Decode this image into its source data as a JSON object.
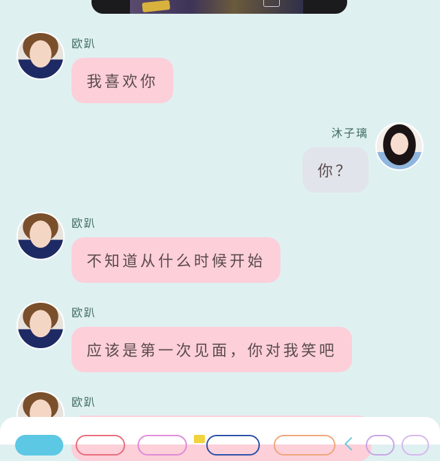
{
  "messages": [
    {
      "sender": "欧趴",
      "text": "我喜欢你",
      "side": "left"
    },
    {
      "sender": "沐子璃",
      "text": "你？",
      "side": "right"
    },
    {
      "sender": "欧趴",
      "text": "不知道从什么时候开始",
      "side": "left"
    },
    {
      "sender": "欧趴",
      "text": "应该是第一次见面，你对我笑吧",
      "side": "left"
    },
    {
      "sender": "欧趴",
      "text": "",
      "side": "left"
    }
  ],
  "colors": {
    "background": "#dff0f1",
    "bubble_left": "#fccfd9",
    "bubble_right": "#e1e4ea",
    "name": "#3f6a62"
  },
  "toolbar": {
    "chips": [
      "cyan",
      "red",
      "pink",
      "blue",
      "orange",
      "purple"
    ]
  }
}
